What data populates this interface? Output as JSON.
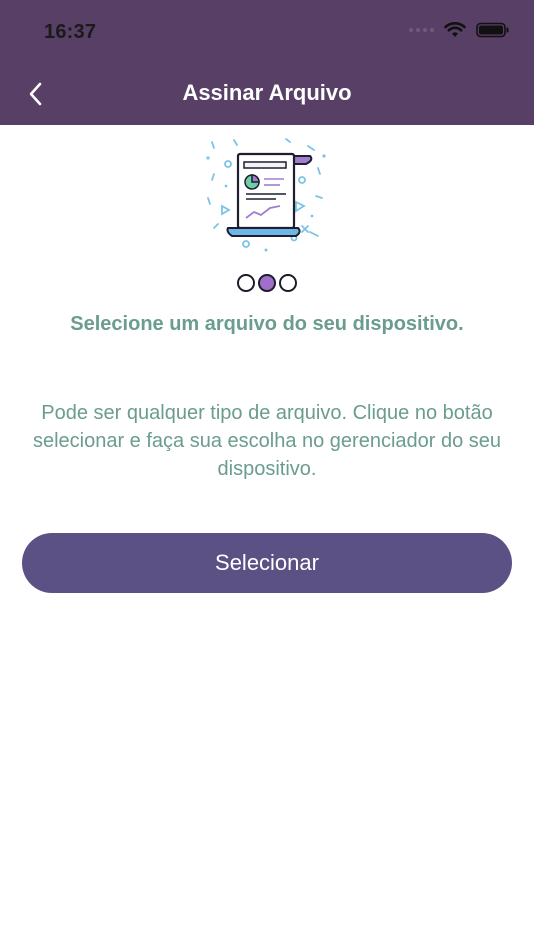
{
  "status_bar": {
    "time": "16:37"
  },
  "nav": {
    "title": "Assinar Arquivo"
  },
  "steps": {
    "total": 3,
    "current": 2
  },
  "content": {
    "headline": "Selecione um arquivo do seu dispositivo.",
    "description": "Pode ser qualquer tipo de arquivo. Clique no botão selecionar e faça sua escolha no gerenciador do seu dispositivo."
  },
  "actions": {
    "select_label": "Selecionar"
  },
  "colors": {
    "header_bg": "#573f66",
    "accent_text": "#6a9c8f",
    "button_bg": "#5c5184",
    "active_dot": "#9f6fcb"
  },
  "icons": {
    "back": "chevron-left-icon",
    "wifi": "wifi-icon",
    "battery": "battery-icon",
    "illustration": "document-chart-icon"
  }
}
